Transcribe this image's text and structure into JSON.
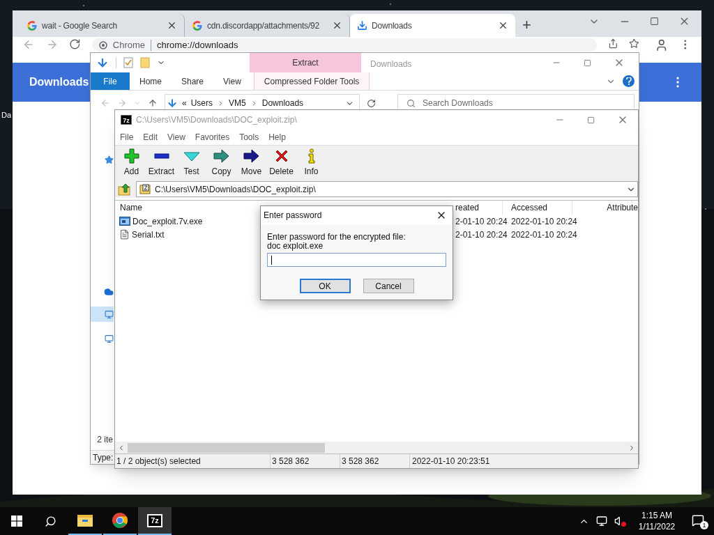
{
  "desktop": {
    "icon_label": "Da"
  },
  "chrome": {
    "tabs": [
      {
        "title": "wait - Google Search",
        "kind": "google",
        "selected": false
      },
      {
        "title": "cdn.discordapp/attachments/92",
        "kind": "google",
        "selected": false
      },
      {
        "title": "Downloads",
        "kind": "download",
        "selected": true
      }
    ],
    "new_tab": "+",
    "omnibox": {
      "chip": "Chrome",
      "url": "chrome://downloads"
    },
    "page_title": "Downloads"
  },
  "explorer": {
    "title": "Downloads",
    "context_tab": "Extract",
    "ribbon_tabs": [
      {
        "label": "File",
        "kind": "file"
      },
      {
        "label": "Home",
        "kind": "plain"
      },
      {
        "label": "Share",
        "kind": "plain"
      },
      {
        "label": "View",
        "kind": "plain"
      },
      {
        "label": "Compressed Folder Tools",
        "kind": "context"
      }
    ],
    "overflow": "«",
    "breadcrumb": [
      "Users",
      "VM5",
      "Downloads"
    ],
    "search_placeholder": "Search Downloads",
    "item_count": "2 ite",
    "details_label": "Type:"
  },
  "sevenzip": {
    "logo": "7z",
    "title": "C:\\Users\\VM5\\Downloads\\DOC_exploit.zip\\",
    "menu": [
      "File",
      "Edit",
      "View",
      "Favorites",
      "Tools",
      "Help"
    ],
    "toolbar": [
      {
        "label": "Add",
        "kind": "add"
      },
      {
        "label": "Extract",
        "kind": "extract"
      },
      {
        "label": "Test",
        "kind": "test"
      },
      {
        "label": "Copy",
        "kind": "copy"
      },
      {
        "label": "Move",
        "kind": "move"
      },
      {
        "label": "Delete",
        "kind": "delete"
      },
      {
        "label": "Info",
        "kind": "info"
      }
    ],
    "path": "C:\\Users\\VM5\\Downloads\\DOC_exploit.zip\\",
    "columns": [
      "Name",
      "reated",
      "Accessed",
      "Attribute"
    ],
    "rows": [
      {
        "name": "Doc_exploit.7v.exe",
        "kind": "exe",
        "created": "2-01-10 20:24",
        "accessed": "2022-01-10 20:24"
      },
      {
        "name": "Serial.txt",
        "kind": "text",
        "created": "2-01-10 20:24",
        "accessed": "2022-01-10 20:24"
      }
    ],
    "status": [
      "1 / 2 object(s) selected",
      "3 528 362",
      "3 528 362",
      "2022-01-10 20:23:51"
    ]
  },
  "dialog": {
    "title": "Enter password",
    "prompt": "Enter password for the encrypted file:",
    "file": "doc exploit.exe",
    "buttons": [
      {
        "label": "OK",
        "default": true
      },
      {
        "label": "Cancel",
        "default": false
      }
    ]
  },
  "taskbar": {
    "apps": [
      {
        "kind": "explorer",
        "active": false
      },
      {
        "kind": "chrome",
        "active": false
      },
      {
        "kind": "sevenzip",
        "label": "7z",
        "active": true
      }
    ],
    "clock": {
      "time": "1:15 AM",
      "date": "1/11/2022"
    },
    "notifications": "1"
  }
}
